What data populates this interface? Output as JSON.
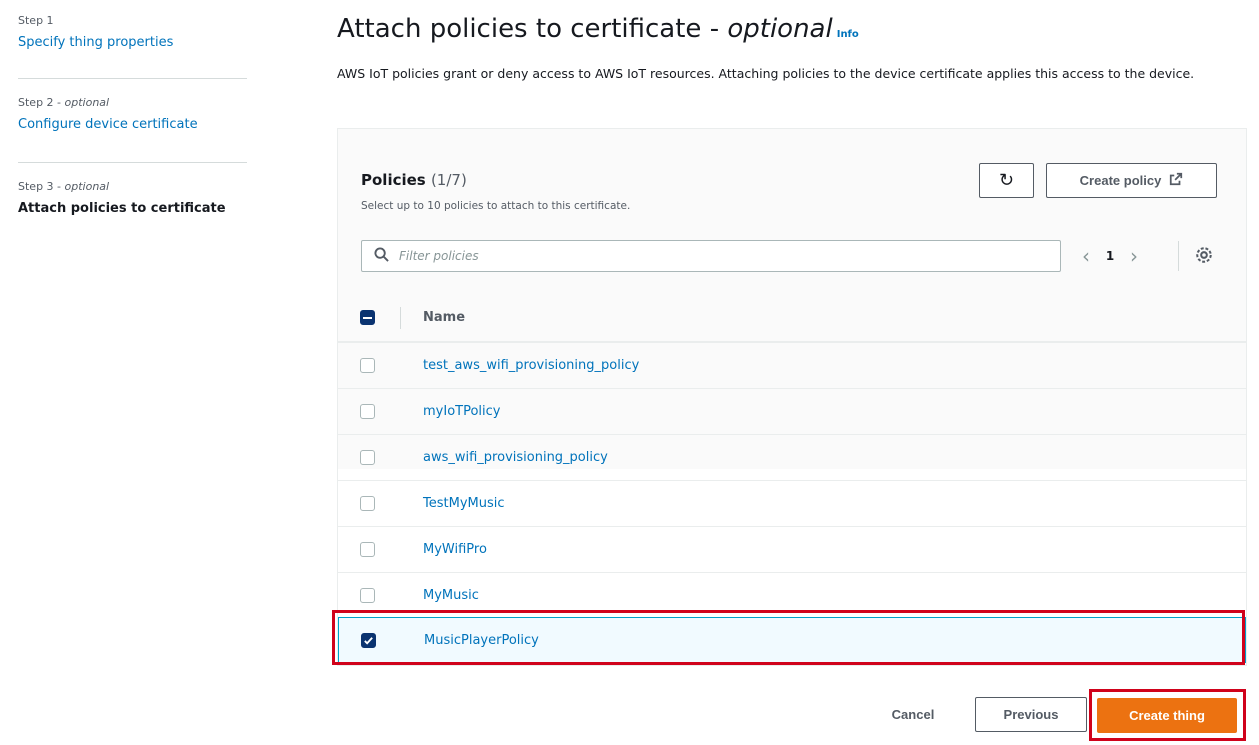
{
  "nav": {
    "steps": [
      {
        "label": "Step 1",
        "optional": "",
        "title": "Specify thing properties"
      },
      {
        "label": "Step 2",
        "optional": "optional",
        "title": "Configure device certificate"
      },
      {
        "label": "Step 3",
        "optional": "optional",
        "title": "Attach policies to certificate"
      }
    ],
    "separator": " - "
  },
  "page": {
    "title_main": "Attach policies to certificate - ",
    "title_optional": "optional",
    "info": "Info",
    "description": "AWS IoT policies grant or deny access to AWS IoT resources. Attaching policies to the device certificate applies this access to the device."
  },
  "policies": {
    "title": "Policies",
    "count": "(1/7)",
    "description": "Select up to 10 policies to attach to this certificate.",
    "create_policy": "Create policy",
    "filter_placeholder": "Filter policies",
    "page_number": "1",
    "column_name": "Name",
    "rows": [
      {
        "name": "test_aws_wifi_provisioning_policy",
        "checked": false
      },
      {
        "name": "myIoTPolicy",
        "checked": false
      },
      {
        "name": "aws_wifi_provisioning_policy",
        "checked": false
      },
      {
        "name": "TestMyMusic",
        "checked": false
      },
      {
        "name": "MyWifiPro",
        "checked": false
      },
      {
        "name": "MyMusic",
        "checked": false
      },
      {
        "name": "MusicPlayerPolicy",
        "checked": true
      }
    ]
  },
  "footer": {
    "cancel": "Cancel",
    "previous": "Previous",
    "create_thing": "Create thing"
  },
  "colors": {
    "link": "#0073bb",
    "primary_button": "#ec7211",
    "checkbox_checked": "#0a3370",
    "annotation_highlight": "#d0021b"
  },
  "icons": {
    "refresh": "refresh-icon",
    "external_link": "external-link-icon",
    "search": "search-icon",
    "settings": "gear-icon"
  }
}
